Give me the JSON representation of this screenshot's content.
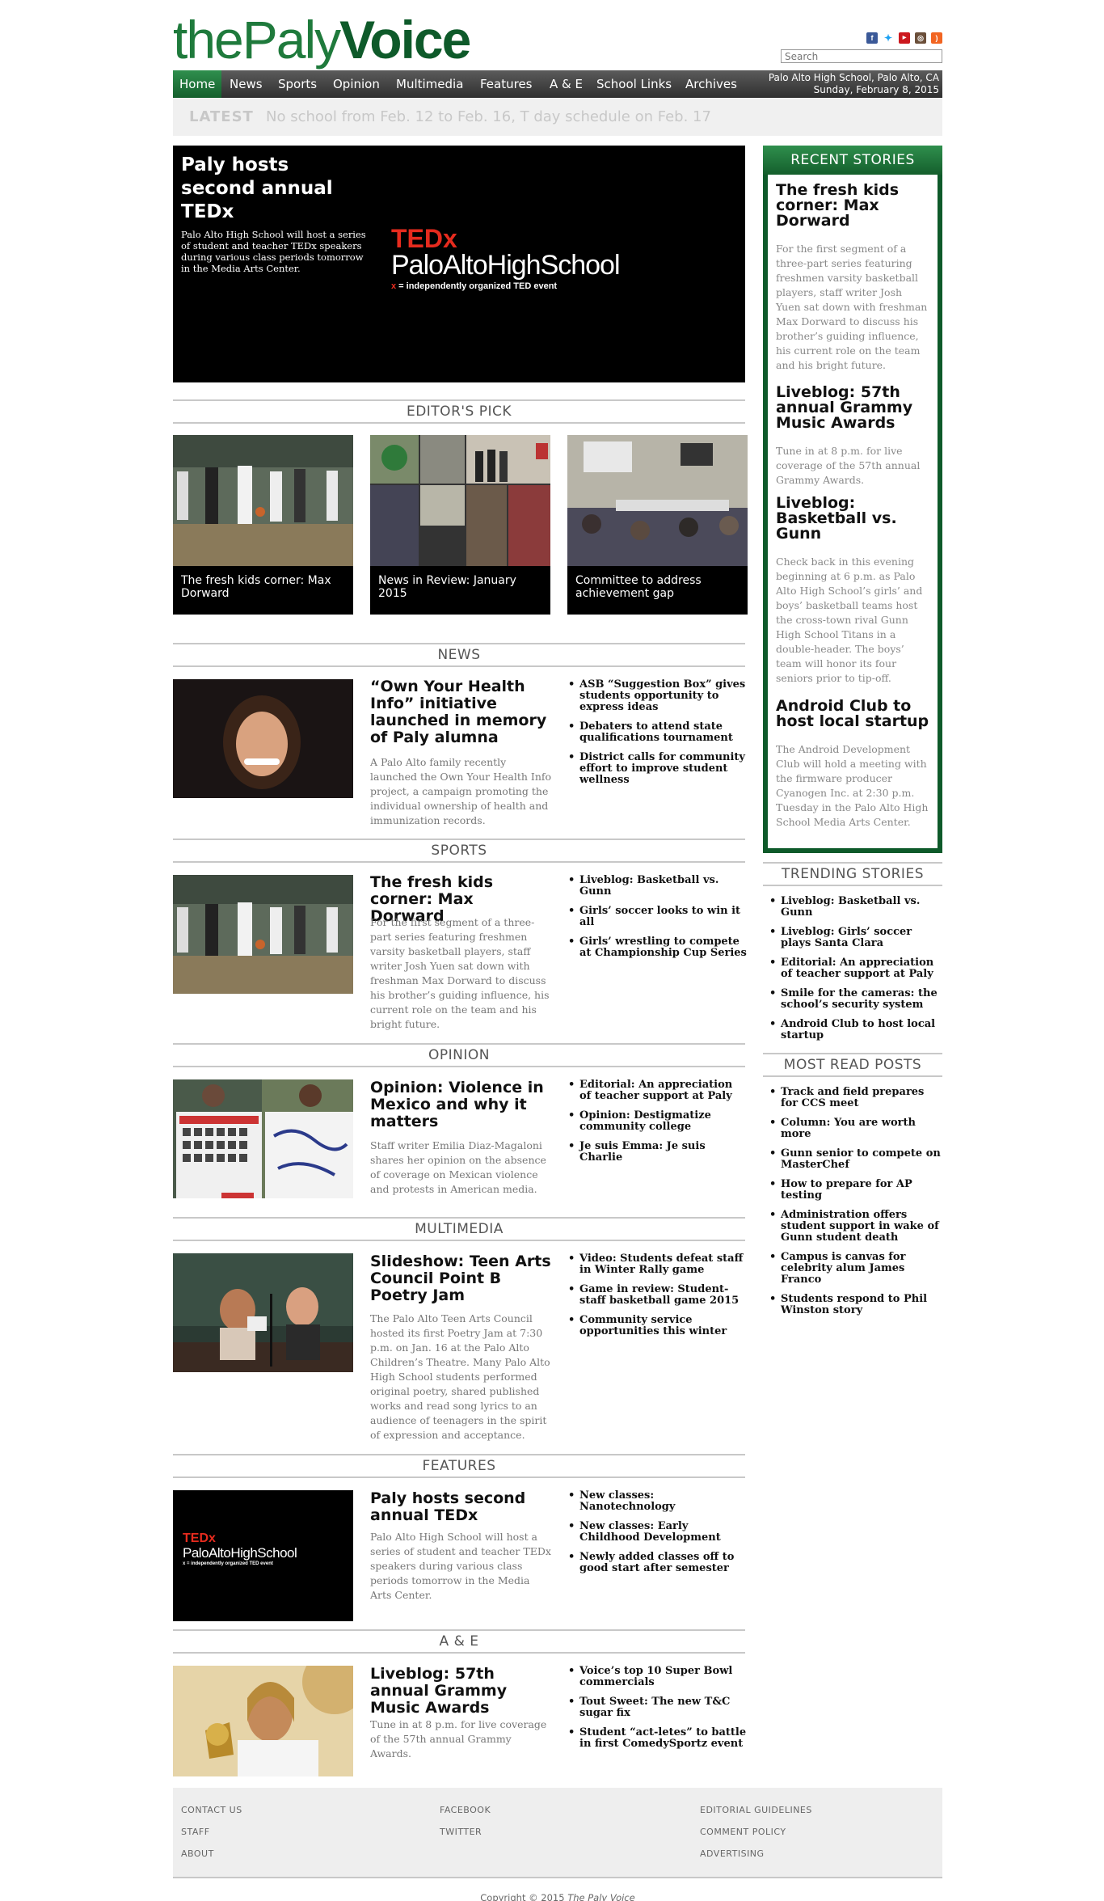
{
  "header": {
    "logo_the": "the",
    "logo_paly": "Paly",
    "logo_voice": "Voice",
    "search_placeholder": "Search",
    "social_icons": [
      "facebook-icon",
      "twitter-icon",
      "youtube-icon",
      "instagram-icon",
      "rss-icon"
    ]
  },
  "nav": {
    "items": [
      "Home",
      "News",
      "Sports",
      "Opinion",
      "Multimedia",
      "Features",
      "A & E",
      "School Links",
      "Archives"
    ],
    "location": "Palo Alto High School, Palo Alto, CA",
    "date": "Sunday, February 8, 2015"
  },
  "latest": {
    "label": "LATEST",
    "text": "No school from Feb. 12 to Feb. 16, T day schedule on Feb. 17"
  },
  "hero": {
    "title": "Paly hosts second annual TEDx",
    "desc": "Palo Alto High School will host a series of student and teacher TEDx speakers during various class periods tomorrow in the Media Arts Center.",
    "logo_ted": "TEDx",
    "logo_school": "PaloAltoHighSchool",
    "logo_tag_x": "x",
    "logo_tag": " = independently organized TED event"
  },
  "editors_pick": {
    "heading": "EDITOR'S PICK",
    "items": [
      {
        "caption": "The fresh kids corner: Max Dorward"
      },
      {
        "caption": "News in Review: January 2015"
      },
      {
        "caption": "Committee to address achievement gap"
      }
    ]
  },
  "sections": [
    {
      "heading": "NEWS",
      "title": "“Own Your Health Info” initiative launched in memory of Paly alumna",
      "desc": "A Palo Alto family recently launched the Own Your Health Info project, a campaign promoting the individual ownership of health and immunization records.",
      "links": [
        "ASB “Suggestion Box” gives students opportunity to express ideas",
        "Debaters to attend state qualifications tournament",
        "District calls for community effort to improve student wellness"
      ]
    },
    {
      "heading": "SPORTS",
      "title": "The fresh kids corner: Max Dorward",
      "desc": "For the first segment of a three-part series featuring freshmen varsity basketball players, staff writer Josh Yuen sat down with freshman Max Dorward to discuss his brother’s guiding influence, his current role on the team and his bright future.",
      "links": [
        "Liveblog: Basketball vs. Gunn",
        "Girls’ soccer looks to win it all",
        "Girls’ wrestling to compete at Championship Cup Series"
      ]
    },
    {
      "heading": "OPINION",
      "title": "Opinion: Violence in Mexico and why it matters",
      "desc": "Staff writer Emilia Diaz-Magaloni shares her opinion on the absence of coverage on Mexican violence and protests in American media.",
      "links": [
        "Editorial: An appreciation of teacher support at Paly",
        "Opinion: Destigmatize community college",
        "Je suis Emma: Je suis Charlie"
      ]
    },
    {
      "heading": "MULTIMEDIA",
      "title": "Slideshow: Teen Arts Council Point B Poetry Jam",
      "desc": "The Palo Alto Teen Arts Council hosted its first Poetry Jam at 7:30 p.m. on Jan. 16 at the Palo Alto Children’s Theatre. Many Palo Alto High School students performed original poetry, shared published works and read song lyrics to an audience of teenagers in the spirit of expression and acceptance.",
      "links": [
        "Video: Students defeat staff in Winter Rally game",
        "Game in review: Student-staff basketball game 2015",
        "Community service opportunities this winter"
      ]
    },
    {
      "heading": "FEATURES",
      "title": "Paly hosts second annual TEDx",
      "desc": "Palo Alto High School will host a series of student and teacher TEDx speakers during various class periods tomorrow in the Media Arts Center.",
      "links": [
        "New classes: Nanotechnology",
        "New classes: Early Childhood Development",
        "Newly added classes off to good start after semester"
      ]
    },
    {
      "heading": "A & E",
      "title": "Liveblog: 57th annual Grammy Music Awards",
      "desc": "Tune in at 8 p.m. for live coverage of the 57th annual Grammy Awards.",
      "links": [
        "Voice’s top 10 Super Bowl commercials",
        "Tout Sweet: The new T&C sugar fix",
        "Student “act-letes” to battle in first ComedySportz event"
      ]
    }
  ],
  "features_thumb": {
    "ted": "TEDx",
    "school": "PaloAltoHighSchool",
    "tag": "x = independently organized TED event"
  },
  "recent": {
    "heading": "RECENT STORIES",
    "stories": [
      {
        "title": "The fresh kids corner: Max Dorward",
        "desc": "For the first segment of a three-part series featuring freshmen varsity basketball players, staff writer Josh Yuen sat down with freshman Max Dorward to discuss his brother’s guiding influence, his current role on the team and his bright future."
      },
      {
        "title": "Liveblog: 57th annual Grammy Music Awards",
        "desc": "Tune in at 8 p.m. for live coverage of the 57th annual Grammy Awards."
      },
      {
        "title": "Liveblog: Basketball vs. Gunn",
        "desc": "Check back in this evening beginning at 6 p.m. as Palo Alto High School’s girls’ and boys’ basketball teams host the cross-town rival Gunn High School Titans in a double-header. The boys’ team will honor its four seniors prior to tip-off."
      },
      {
        "title": "Android Club to host local startup",
        "desc": "The Android Development Club will hold a meeting with the firmware producer Cyanogen Inc. at 2:30 p.m. Tuesday in the Palo Alto High School Media Arts Center."
      }
    ]
  },
  "trending": {
    "heading": "TRENDING STORIES",
    "items": [
      "Liveblog: Basketball vs. Gunn",
      "Liveblog: Girls’ soccer plays Santa Clara",
      "Editorial: An appreciation of teacher support at Paly",
      "Smile for the cameras: the school’s security system",
      "Android Club to host local startup"
    ]
  },
  "most_read": {
    "heading": "MOST READ POSTS",
    "items": [
      "Track and field prepares for CCS meet",
      "Column: You are worth more",
      "Gunn senior to compete on MasterChef",
      "How to prepare for AP testing",
      "Administration offers student support in wake of Gunn student death",
      "Campus is canvas for celebrity alum James Franco",
      "Students respond to Phil Winston story"
    ]
  },
  "footer": {
    "col1": [
      "CONTACT US",
      "STAFF",
      "ABOUT"
    ],
    "col2": [
      "FACEBOOK",
      "TWITTER"
    ],
    "col3": [
      "EDITORIAL GUIDELINES",
      "COMMENT POLICY",
      "ADVERTISING"
    ],
    "copyright_prefix": "Copyright © 2015 ",
    "copyright_name": "The Paly Voice"
  },
  "colors": {
    "brand_green": "#1f7a3c",
    "dark_green": "#0e5a2a",
    "ted_red": "#e62b1e"
  }
}
